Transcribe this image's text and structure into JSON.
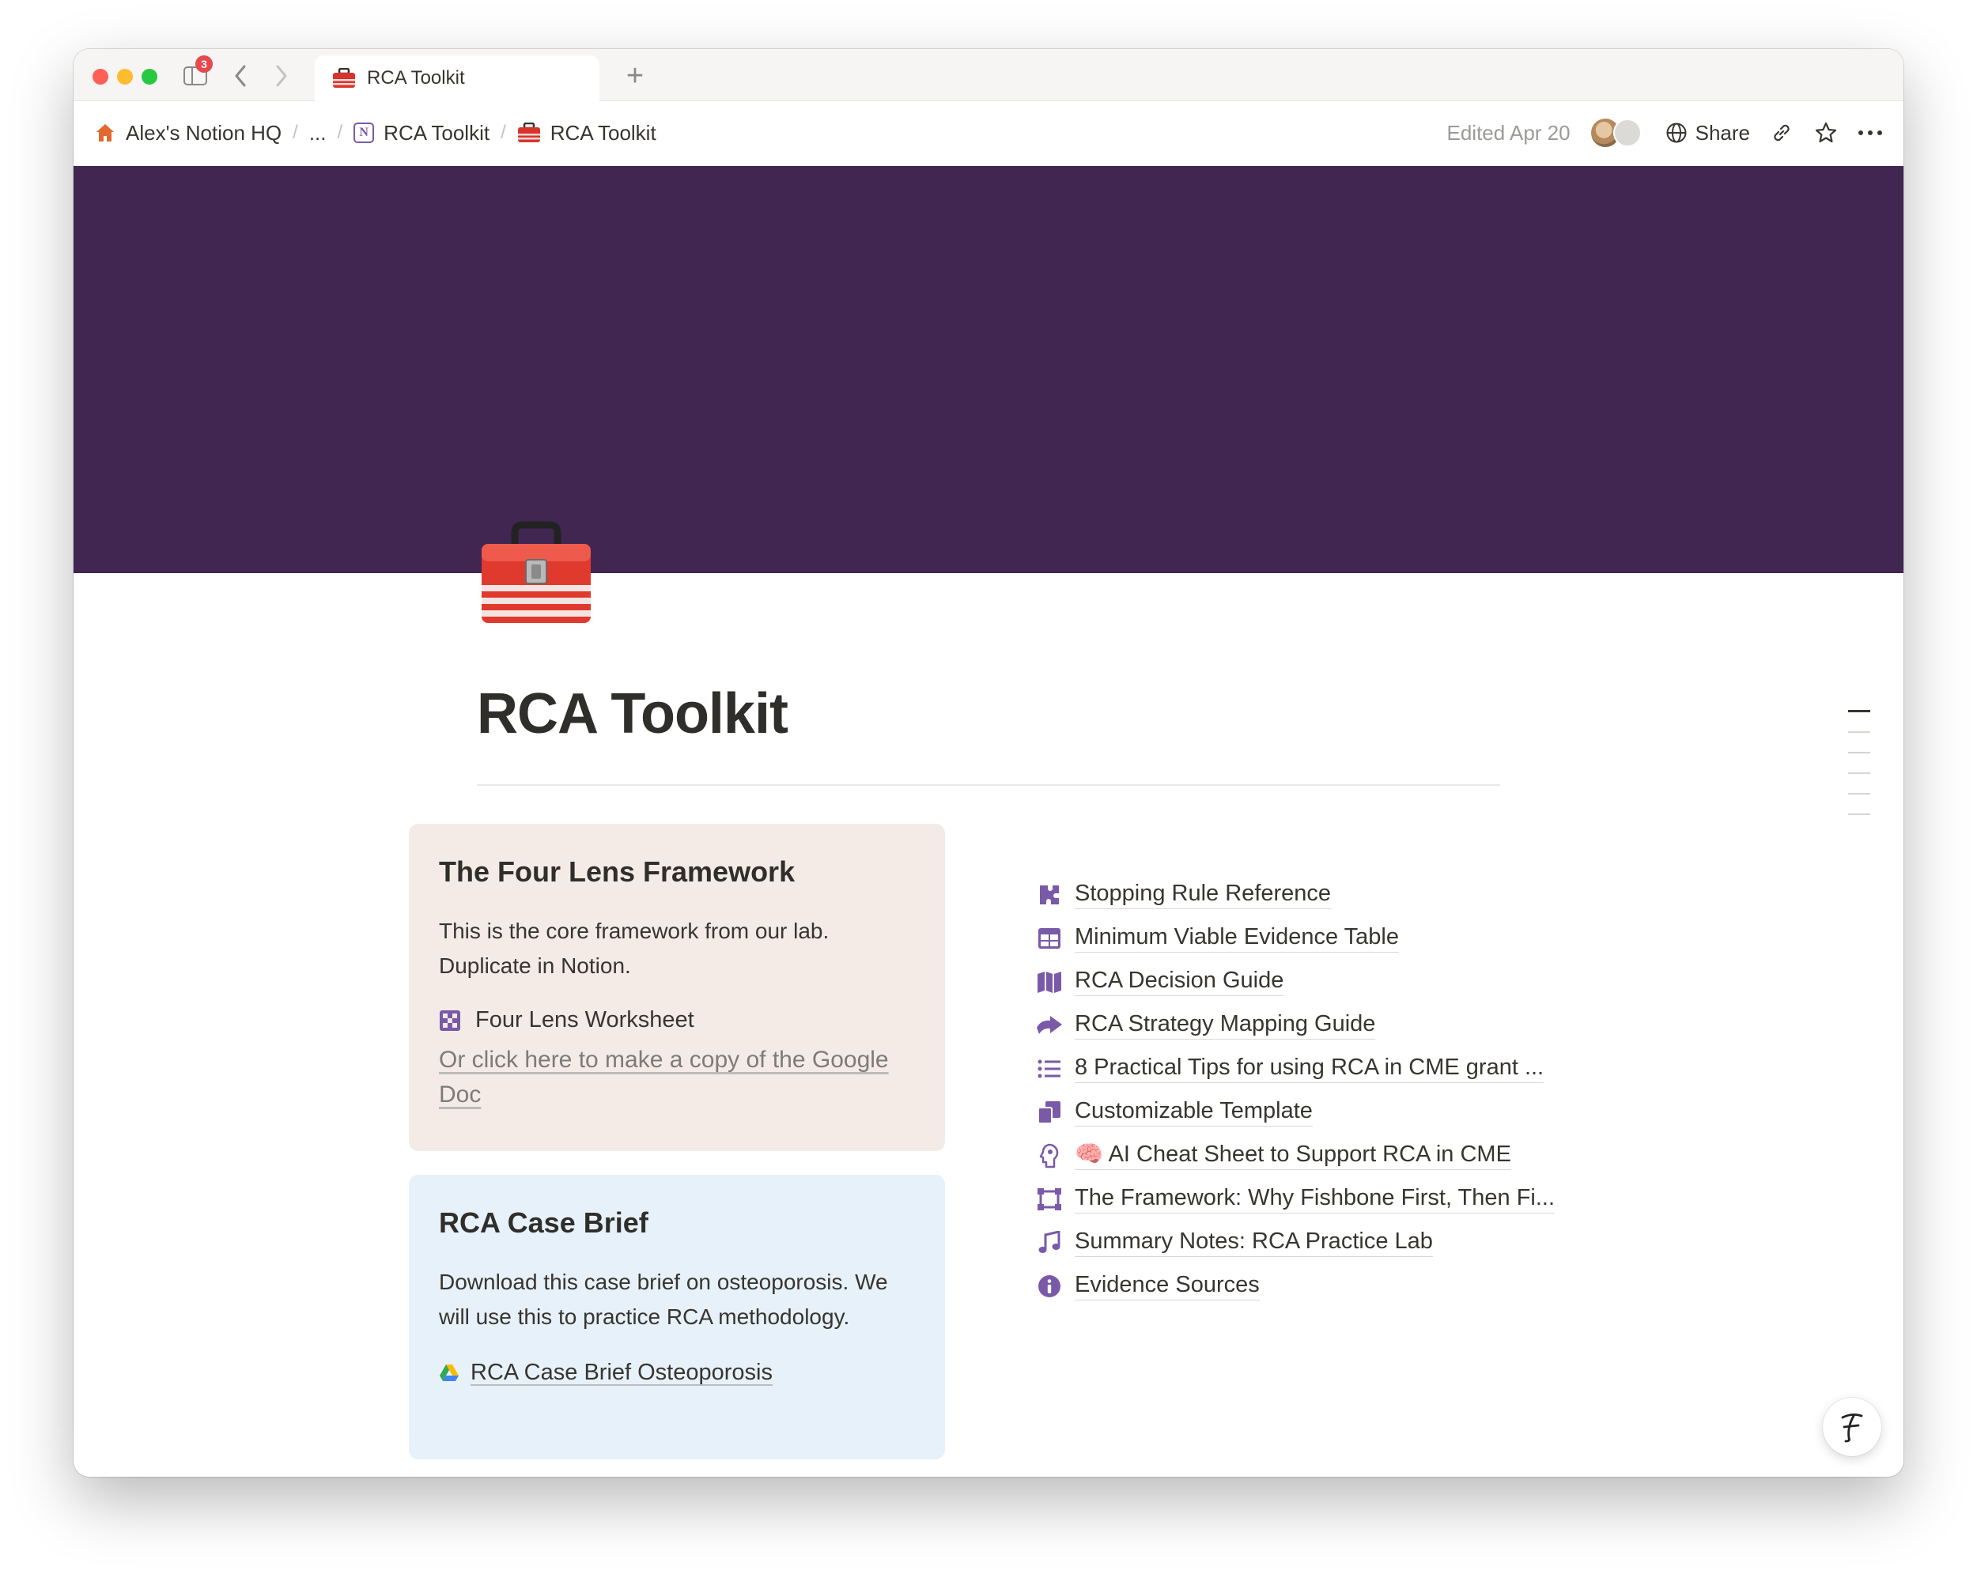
{
  "tab": {
    "title": "RCA Toolkit",
    "notification_count": "3"
  },
  "breadcrumb": {
    "items": [
      {
        "label": "Alex's Notion HQ",
        "icon": "house-icon"
      },
      {
        "label": "..."
      },
      {
        "label": "RCA Toolkit",
        "icon": "notion-icon"
      },
      {
        "label": "RCA Toolkit",
        "icon": "toolbox-icon"
      }
    ]
  },
  "header": {
    "edited": "Edited Apr 20",
    "share_label": "Share"
  },
  "page": {
    "title": "RCA Toolkit",
    "cover_color": "#412651"
  },
  "callouts": {
    "framework": {
      "title": "The Four Lens Framework",
      "body": "This is the core framework from our lab. Duplicate in Notion.",
      "link_label": "Four Lens Worksheet",
      "gdoc_label": "Or click here to make a copy of the Google Doc"
    },
    "case_brief": {
      "title": "RCA Case Brief",
      "body": "Download this case brief on osteoporosis. We will use this to practice RCA methodology.",
      "link_label": "RCA Case Brief Osteoporosis"
    }
  },
  "links": [
    {
      "label": "Stopping Rule Reference",
      "icon": "puzzle-icon"
    },
    {
      "label": "Minimum Viable Evidence Table",
      "icon": "table-icon"
    },
    {
      "label": "RCA Decision Guide",
      "icon": "map-icon"
    },
    {
      "label": "RCA Strategy Mapping Guide",
      "icon": "arrow-icon"
    },
    {
      "label": "8 Practical Tips for using RCA in CME grant ...",
      "icon": "list-icon"
    },
    {
      "label": "Customizable Template",
      "icon": "copy-icon"
    },
    {
      "label": "🧠 AI Cheat Sheet to Support RCA in CME",
      "icon": "brain-head-icon"
    },
    {
      "label": "The Framework: Why Fishbone First, Then Fi...",
      "icon": "frame-icon"
    },
    {
      "label": "Summary Notes: RCA Practice Lab",
      "icon": "music-note-icon"
    },
    {
      "label": "Evidence Sources",
      "icon": "info-icon"
    }
  ],
  "colors": {
    "accent_purple": "#7a5aa8",
    "callout_brown": "#f4ebe7",
    "callout_blue": "#e7f1fa"
  }
}
